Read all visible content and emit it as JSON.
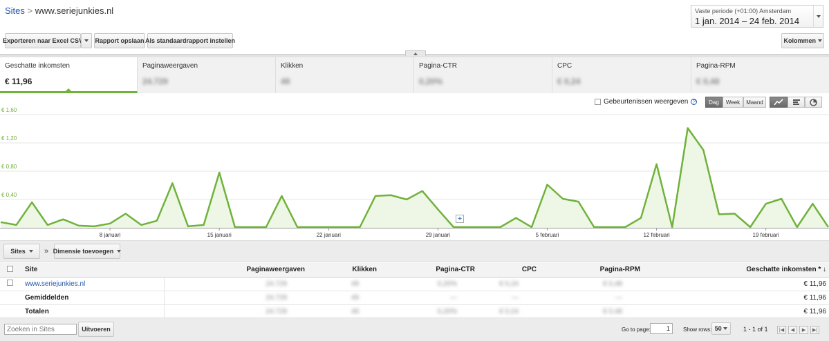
{
  "breadcrumb": {
    "root": "Sites",
    "separator": ">",
    "current": "www.seriejunkies.nl"
  },
  "date_range": {
    "label": "Vaste periode (+01:00) Amsterdam",
    "value": "1 jan. 2014 – 24 feb. 2014"
  },
  "toolbar": {
    "export_label": "Exporteren naar Excel CSV",
    "save_label": "Rapport opslaan",
    "default_label": "Als standaardrapport instellen",
    "columns_label": "Kolommen"
  },
  "metric_tabs": [
    {
      "label": "Geschatte inkomsten",
      "value": "€ 11,96"
    },
    {
      "label": "Paginaweergaven",
      "value": "24.729"
    },
    {
      "label": "Klikken",
      "value": "49"
    },
    {
      "label": "Pagina-CTR",
      "value": "0,20%"
    },
    {
      "label": "CPC",
      "value": "€ 0,24"
    },
    {
      "label": "Pagina-RPM",
      "value": "€ 0,48"
    }
  ],
  "chart_controls": {
    "events_label": "Gebeurtenissen weergeven",
    "help": "?",
    "day": "Dag",
    "week": "Week",
    "month": "Maand"
  },
  "chart_data": {
    "type": "area",
    "y_ticks": [
      "€ 1,60",
      "€ 1,20",
      "€ 0,80",
      "€ 0,40"
    ],
    "y_tick_values": [
      1.6,
      1.2,
      0.8,
      0.4
    ],
    "ylim": [
      0,
      1.6
    ],
    "x_tick_labels": [
      "8 januari",
      "15 januari",
      "22 januari",
      "29 januari",
      "5 februari",
      "12 februari",
      "19 februari"
    ],
    "x_tick_day_index": [
      7,
      14,
      21,
      28,
      35,
      42,
      49
    ],
    "series": [
      {
        "values": [
          0.08,
          0.04,
          0.36,
          0.04,
          0.12,
          0.03,
          0.02,
          0.06,
          0.2,
          0.04,
          0.1,
          0.63,
          0.02,
          0.04,
          0.78,
          0.01,
          0.01,
          0.01,
          0.45,
          0.01,
          0.01,
          0.01,
          0.01,
          0.01,
          0.45,
          0.46,
          0.4,
          0.52,
          0.26,
          0.01,
          0.01,
          0.01,
          0.01,
          0.14,
          0.01,
          0.61,
          0.41,
          0.37,
          0.01,
          0.01,
          0.01,
          0.14,
          0.9,
          0.01,
          1.41,
          1.1,
          0.19,
          0.2,
          0.01,
          0.34,
          0.41,
          0.01,
          0.34,
          0.01
        ],
        "color": "#6fb23a"
      }
    ],
    "annotation_marker": "+"
  },
  "dimension_bar": {
    "sites_label": "Sites",
    "chevron": "»",
    "add_label": "Dimensie toevoegen"
  },
  "table": {
    "headers": [
      "Site",
      "Paginaweergaven",
      "Klikken",
      "Pagina-CTR",
      "CPC",
      "Pagina-RPM",
      "Geschatte inkomsten * ↓"
    ],
    "rows": [
      {
        "cells": [
          "www.seriejunkies.nl",
          "24.729",
          "49",
          "0,20%",
          "€ 0,24",
          "€ 0,48",
          "€ 11,96"
        ]
      },
      {
        "cells": [
          "Gemiddelden",
          "24.729",
          "49",
          "—",
          "—",
          "—",
          "€ 11,96"
        ]
      },
      {
        "cells": [
          "Totalen",
          "24.729",
          "49",
          "0,20%",
          "€ 0,24",
          "€ 0,48",
          "€ 11,96"
        ]
      }
    ]
  },
  "footer": {
    "search_placeholder": "Zoeken in Sites",
    "run_label": "Uitvoeren",
    "goto_label": "Go to page:",
    "goto_value": "1",
    "show_rows_label": "Show rows:",
    "show_rows_value": "50",
    "range_label": "1 - 1 of 1"
  }
}
